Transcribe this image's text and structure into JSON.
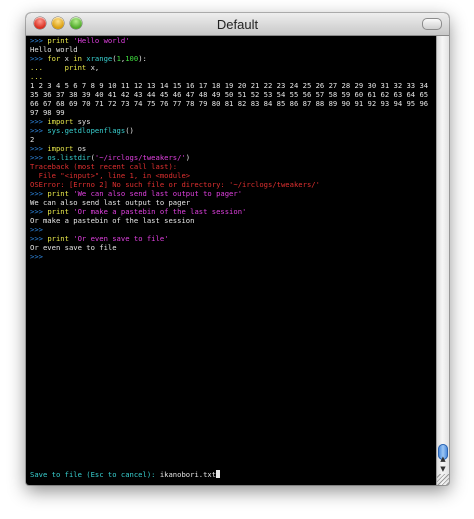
{
  "window": {
    "title": "Default"
  },
  "colors": {
    "prompt": "#2f8ae6",
    "keyword": "#e8e84a",
    "string": "#e040e0",
    "call": "#38d0d0",
    "number": "#40e040",
    "error": "#e03030",
    "output": "#e6e6e6",
    "background": "#000000"
  },
  "terminal": {
    "lines": [
      [
        {
          "c": "p",
          "t": ">>> "
        },
        {
          "c": "kw",
          "t": "print "
        },
        {
          "c": "str",
          "t": "'Hello world'"
        }
      ],
      [
        {
          "c": "out",
          "t": "Hello world"
        }
      ],
      [
        {
          "c": "p",
          "t": ">>> "
        },
        {
          "c": "kw",
          "t": "for "
        },
        {
          "c": "out",
          "t": "x "
        },
        {
          "c": "kw",
          "t": "in "
        },
        {
          "c": "cy",
          "t": "xrange"
        },
        {
          "c": "out",
          "t": "("
        },
        {
          "c": "num",
          "t": "1"
        },
        {
          "c": "out",
          "t": ","
        },
        {
          "c": "num",
          "t": "100"
        },
        {
          "c": "out",
          "t": "):"
        }
      ],
      [
        {
          "c": "dots",
          "t": "...     "
        },
        {
          "c": "kw",
          "t": "print "
        },
        {
          "c": "out",
          "t": "x,"
        }
      ],
      [
        {
          "c": "dots",
          "t": "..."
        }
      ],
      [
        {
          "c": "out",
          "t": "1 2 3 4 5 6 7 8 9 10 11 12 13 14 15 16 17 18 19 20 21 22 23 24 25 26 27 28 29 30 31 32 33 34 35 36 37 38 39 40 41 42 43 44 45 46 47 48 49 50 51 52 53 54 55 56 57 58 59 60 61 62 63 64 65 66 67 68 69 70 71 72 73 74 75 76 77 78 79 80 81 82 83 84 85 86 87 88 89 90 91 92 93 94 95 96 97 98 99"
        }
      ],
      [
        {
          "c": "p",
          "t": ">>> "
        },
        {
          "c": "kw",
          "t": "import "
        },
        {
          "c": "out",
          "t": "sys"
        }
      ],
      [
        {
          "c": "p",
          "t": ">>> "
        },
        {
          "c": "cy",
          "t": "sys.getdlopenflags"
        },
        {
          "c": "out",
          "t": "()"
        }
      ],
      [
        {
          "c": "out",
          "t": "2"
        }
      ],
      [
        {
          "c": "p",
          "t": ">>> "
        },
        {
          "c": "kw",
          "t": "import "
        },
        {
          "c": "out",
          "t": "os"
        }
      ],
      [
        {
          "c": "p",
          "t": ">>> "
        },
        {
          "c": "cy",
          "t": "os.listdir"
        },
        {
          "c": "out",
          "t": "("
        },
        {
          "c": "str",
          "t": "'~/irclogs/tweakers/'"
        },
        {
          "c": "out",
          "t": ")"
        }
      ],
      [
        {
          "c": "err",
          "t": "Traceback (most recent call last):"
        }
      ],
      [
        {
          "c": "err",
          "t": "  File \"<input>\", line 1, in <module>"
        }
      ],
      [
        {
          "c": "err",
          "t": "OSError: [Errno 2] No such file or directory: '~/irclogs/tweakers/'"
        }
      ],
      [
        {
          "c": "p",
          "t": ">>> "
        },
        {
          "c": "kw",
          "t": "print "
        },
        {
          "c": "str",
          "t": "'We can also send last output to pager'"
        }
      ],
      [
        {
          "c": "out",
          "t": "We can also send last output to pager"
        }
      ],
      [
        {
          "c": "p",
          "t": ">>> "
        },
        {
          "c": "kw",
          "t": "print "
        },
        {
          "c": "str",
          "t": "'Or make a pastebin of the last session'"
        }
      ],
      [
        {
          "c": "out",
          "t": "Or make a pastebin of the last session"
        }
      ],
      [
        {
          "c": "p",
          "t": ">>>"
        }
      ],
      [
        {
          "c": "p",
          "t": ">>> "
        },
        {
          "c": "kw",
          "t": "print "
        },
        {
          "c": "str",
          "t": "'Or even save to file'"
        }
      ],
      [
        {
          "c": "out",
          "t": "Or even save to file"
        }
      ],
      [
        {
          "c": "p",
          "t": ">>>"
        }
      ]
    ],
    "status_label": "Save to file (Esc to cancel): ",
    "status_value": "ikanobori.txt"
  },
  "scrollbar": {
    "up_arrow": "▲",
    "down_arrow": "▼",
    "position_percent": 100
  }
}
